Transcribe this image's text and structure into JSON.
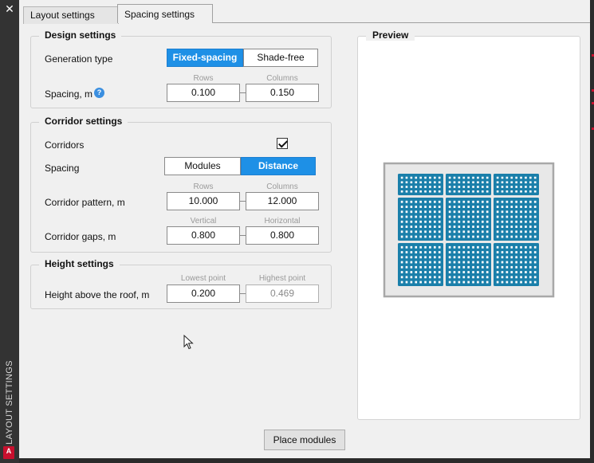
{
  "window": {
    "title_vertical": "LAYOUT SETTINGS",
    "close_glyph": "✕",
    "logo_text": "A"
  },
  "tabs": [
    {
      "label": "Layout settings",
      "active": false
    },
    {
      "label": "Spacing settings",
      "active": true
    }
  ],
  "design": {
    "title": "Design settings",
    "generation_type_label": "Generation type",
    "options": [
      "Fixed-spacing",
      "Shade-free"
    ],
    "selected": "Fixed-spacing",
    "rows_label": "Rows",
    "columns_label": "Columns",
    "spacing_label": "Spacing, m",
    "help_glyph": "?",
    "rows_value": "0.100",
    "columns_value": "0.150"
  },
  "corridor": {
    "title": "Corridor settings",
    "corridors_label": "Corridors",
    "corridors_checked": true,
    "spacing_label": "Spacing",
    "spacing_options": [
      "Modules",
      "Distance"
    ],
    "spacing_selected": "Distance",
    "rows_label": "Rows",
    "columns_label": "Columns",
    "pattern_label": "Corridor pattern, m",
    "pattern_rows": "10.000",
    "pattern_columns": "12.000",
    "vertical_label": "Vertical",
    "horizontal_label": "Horizontal",
    "gaps_label": "Corridor gaps, m",
    "gap_vertical": "0.800",
    "gap_horizontal": "0.800"
  },
  "height": {
    "title": "Height settings",
    "lowest_label": "Lowest point",
    "highest_label": "Highest point",
    "height_label": "Height above the roof, m",
    "lowest_value": "0.200",
    "highest_value": "0.469"
  },
  "preview": {
    "title": "Preview",
    "roof_color": "#e8e8e8",
    "module_color": "#1a7faa",
    "module_cell_color": "#ffffff",
    "blocks_cols": 3,
    "blocks_rows": 3,
    "cells_per_block_cols": 9,
    "cells_per_block_rows": [
      4,
      8,
      8
    ]
  },
  "actions": {
    "place_modules": "Place modules"
  },
  "colors": {
    "accent": "#1e90e6",
    "panel_bg": "#f0f0f0",
    "frame_bg": "#2b2b2b"
  }
}
